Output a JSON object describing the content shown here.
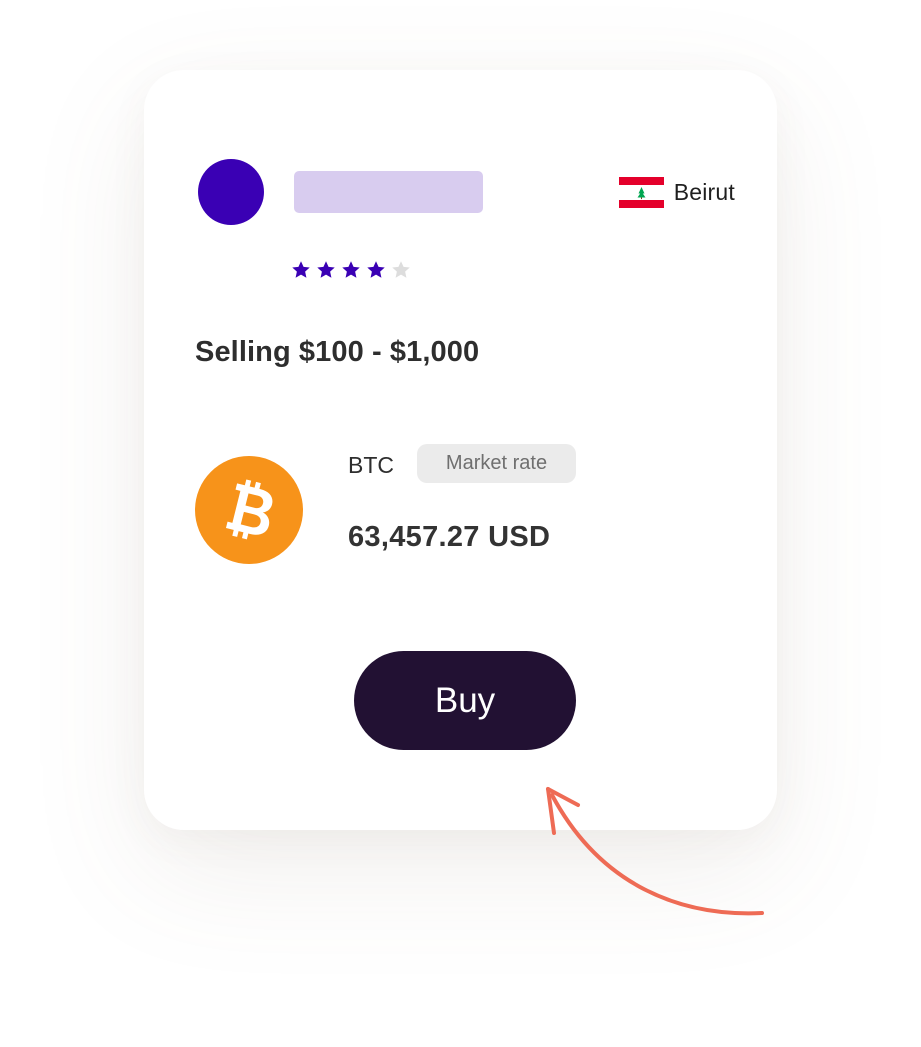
{
  "seller": {
    "avatar_color": "#3a00b4",
    "name_placeholder_color": "#d8ccef",
    "location": "Beirut",
    "flag_icon": "lebanon-flag-icon",
    "rating": 4,
    "rating_max": 5,
    "star_color": "#3a00b4",
    "star_empty_color": "#dddddd"
  },
  "offer": {
    "headline": "Selling $100 - $1,000",
    "coin_icon": "bitcoin-icon",
    "coin_color": "#f7931a",
    "ticker": "BTC",
    "rate_badge": "Market rate",
    "price": "63,457.27 USD"
  },
  "actions": {
    "buy_label": "Buy",
    "buy_color": "#221133"
  },
  "decoration": {
    "arrow_icon": "curved-arrow-icon",
    "arrow_color": "#ee6b55"
  }
}
